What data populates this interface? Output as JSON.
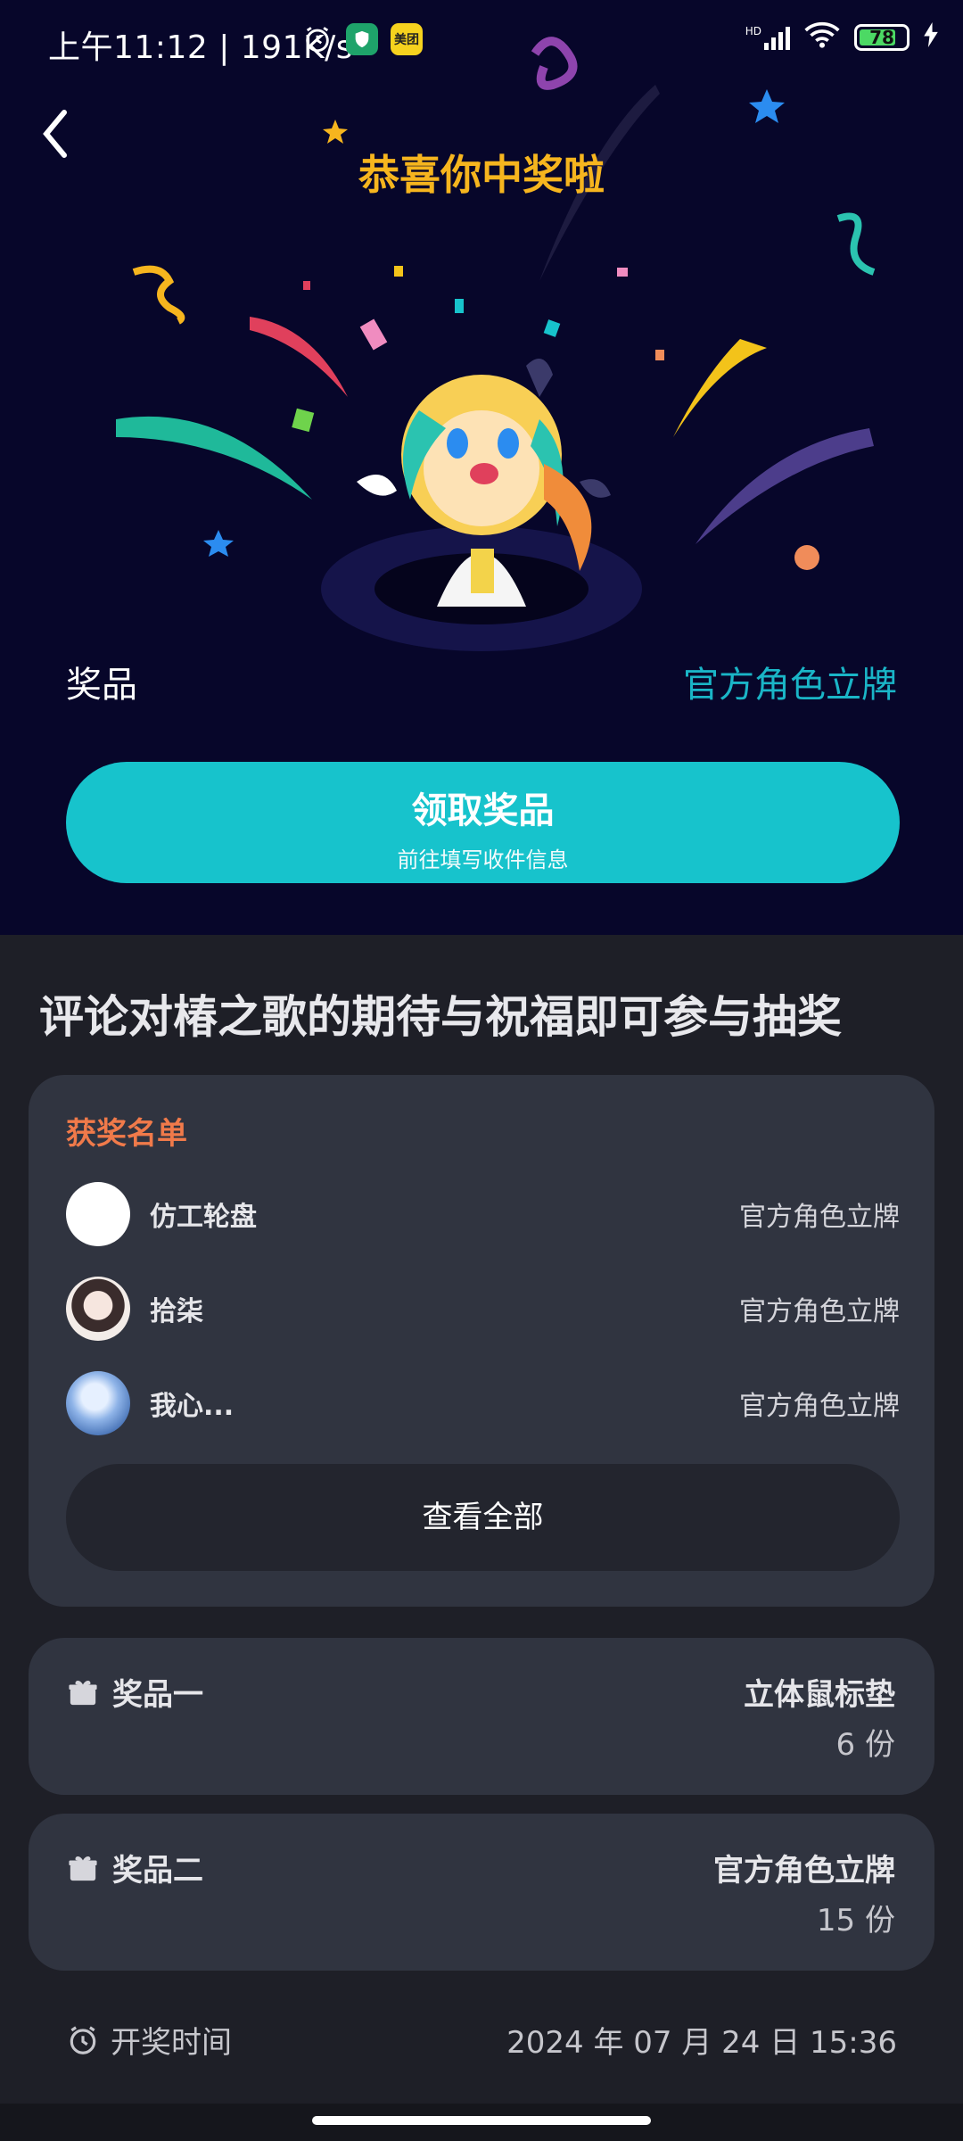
{
  "status_bar": {
    "time": "上午11:12",
    "speed": "191K/s",
    "app_badge": "美团",
    "battery": "78",
    "network": "HD"
  },
  "hero": {
    "title": "恭喜你中奖啦",
    "prize_label": "奖品",
    "prize_value": "官方角色立牌",
    "claim_button": {
      "label": "领取奖品",
      "sublabel": "前往填写收件信息"
    }
  },
  "headline": "评论对椿之歌的期待与祝福即可参与抽奖",
  "winners": {
    "title": "获奖名单",
    "rows": [
      {
        "name": "仿工轮盘",
        "prize": "官方角色立牌"
      },
      {
        "name": "拾柒",
        "prize": "官方角色立牌"
      },
      {
        "name": "我心...",
        "prize": "官方角色立牌"
      }
    ],
    "view_all": "查看全部"
  },
  "prizes": [
    {
      "label": "奖品一",
      "name": "立体鼠标垫",
      "count": "6 份"
    },
    {
      "label": "奖品二",
      "name": "官方角色立牌",
      "count": "15 份"
    }
  ],
  "draw_time": {
    "label": "开奖时间",
    "value": "2024 年 07 月 24 日 15:36"
  },
  "colors": {
    "hero_bg": "#07062a",
    "accent": "#17c3cc",
    "title_gold": "#f6b51e",
    "winners_title": "#f07a4a",
    "card_bg": "#303440"
  }
}
